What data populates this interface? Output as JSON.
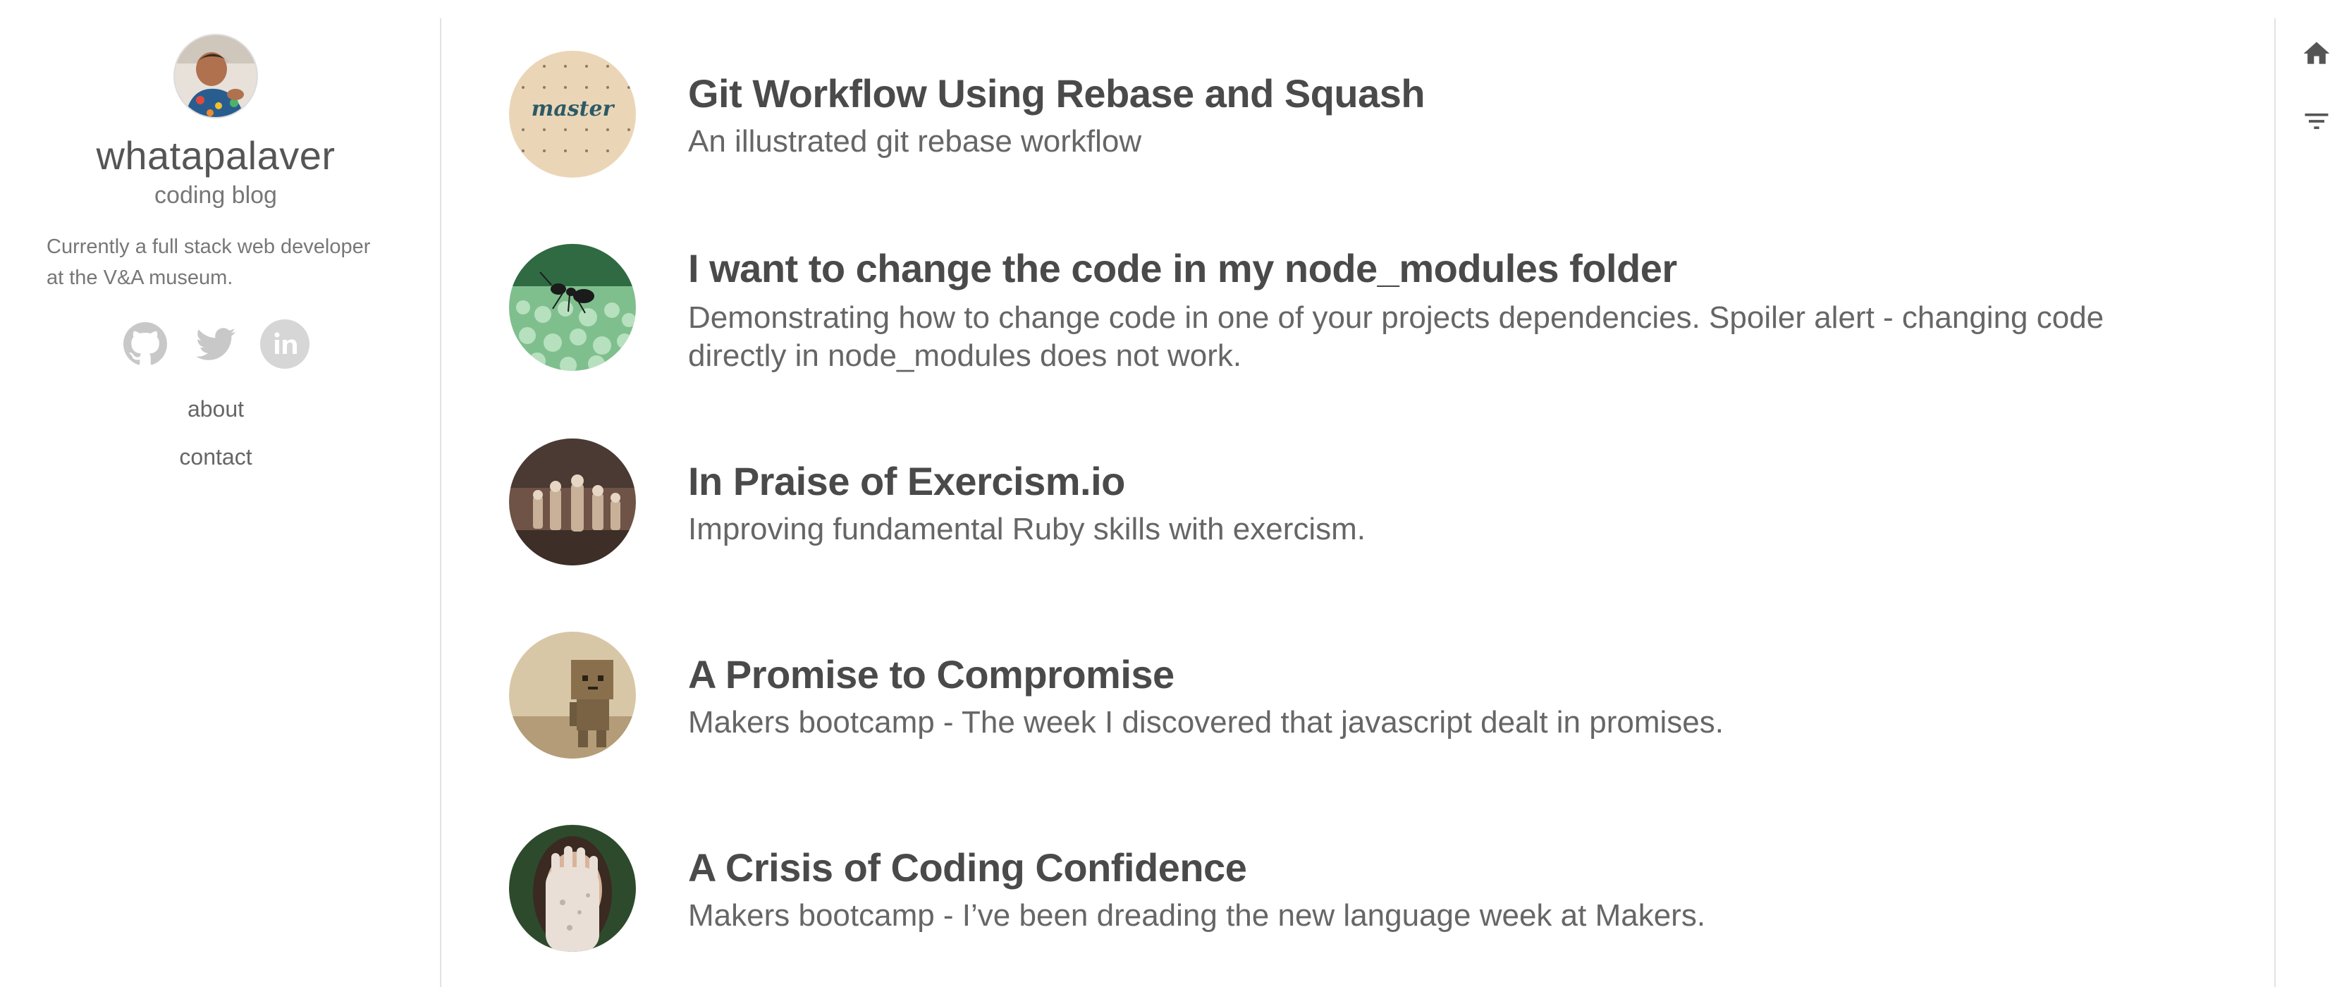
{
  "sidebar": {
    "site_title": "whatapalaver",
    "site_subtitle": "coding blog",
    "bio": "Currently a full stack web developer at the V&A museum.",
    "social": [
      {
        "name": "github",
        "icon": "github-icon"
      },
      {
        "name": "twitter",
        "icon": "twitter-icon"
      },
      {
        "name": "linkedin",
        "icon": "linkedin-icon"
      }
    ],
    "nav": {
      "about": "about",
      "contact": "contact"
    }
  },
  "posts": [
    {
      "title": "Git Workflow Using Rebase and Squash",
      "description": "An illustrated git rebase workflow",
      "thumb_text": "master"
    },
    {
      "title": "I want to change the code in my node_modules folder",
      "description": "Demonstrating how to change code in one of your projects dependencies. Spoiler alert - changing code directly in node_modules does not work."
    },
    {
      "title": "In Praise of Exercism.io",
      "description": "Improving fundamental Ruby skills with exercism."
    },
    {
      "title": "A Promise to Compromise",
      "description": "Makers bootcamp - The week I discovered that javascript dealt in promises."
    },
    {
      "title": "A Crisis of Coding Confidence",
      "description": "Makers bootcamp - I’ve been dreading the new language week at Makers."
    }
  ],
  "right_rail": {
    "home_icon": "home-icon",
    "filter_icon": "filter-icon"
  },
  "colors": {
    "text_dark": "#4a4a4a",
    "text_muted": "#777777",
    "rule": "#e2e2e2",
    "social_grey": "#c8c8c8"
  }
}
